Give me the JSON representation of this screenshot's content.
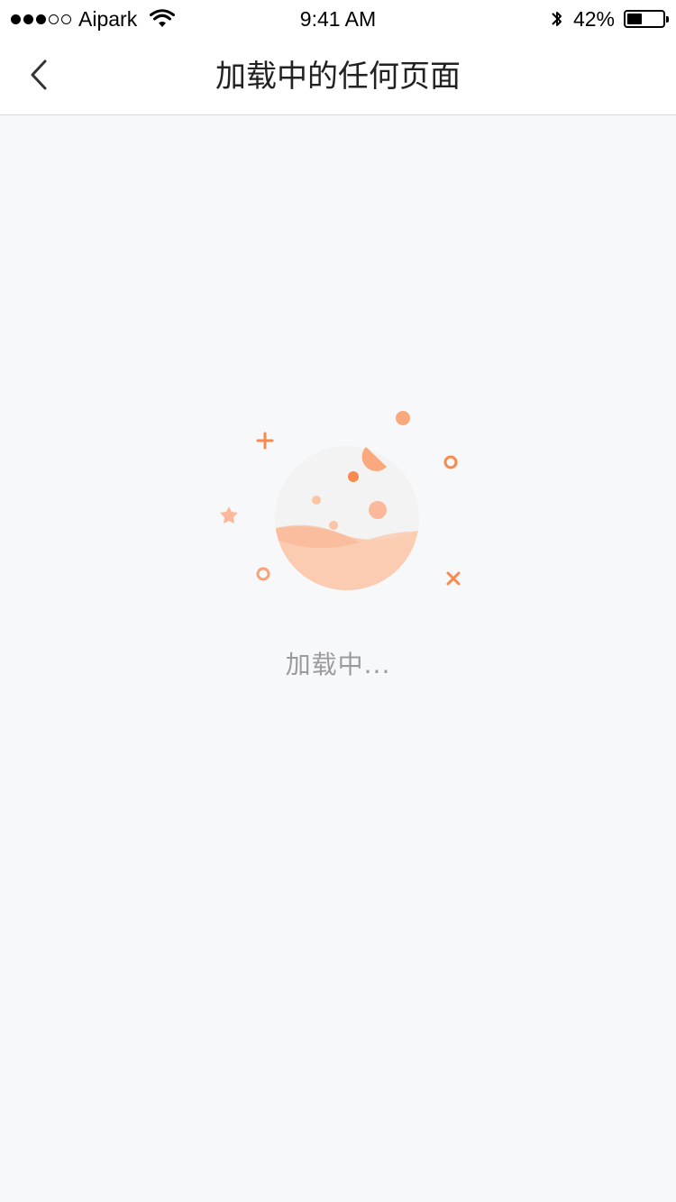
{
  "status_bar": {
    "carrier": "Aipark",
    "time": "9:41 AM",
    "battery_percent": "42%",
    "battery_level": 0.42,
    "signal_bars_filled": 3,
    "signal_bars_total": 5
  },
  "nav": {
    "title": "加载中的任何页面",
    "back_icon": "chevron-left-icon"
  },
  "main": {
    "loading_text": "加载中...",
    "illustration": "loading-planet-illustration"
  },
  "colors": {
    "accent": "#F98A4E",
    "accent_light": "#FBC4A6",
    "background": "#F7F8FA",
    "nav_background": "#FFFFFF",
    "loading_text": "#9B9B9B"
  }
}
